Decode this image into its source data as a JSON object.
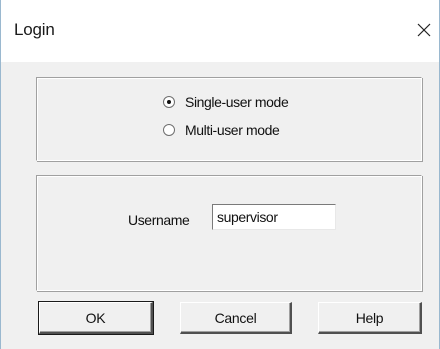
{
  "window": {
    "title": "Login"
  },
  "mode": {
    "options": [
      {
        "label": "Single-user mode",
        "checked": true
      },
      {
        "label": "Multi-user mode",
        "checked": false
      }
    ]
  },
  "user": {
    "label": "Username",
    "value": "supervisor"
  },
  "buttons": {
    "ok": "OK",
    "cancel": "Cancel",
    "help": "Help"
  },
  "icons": {
    "close": "close-icon"
  }
}
